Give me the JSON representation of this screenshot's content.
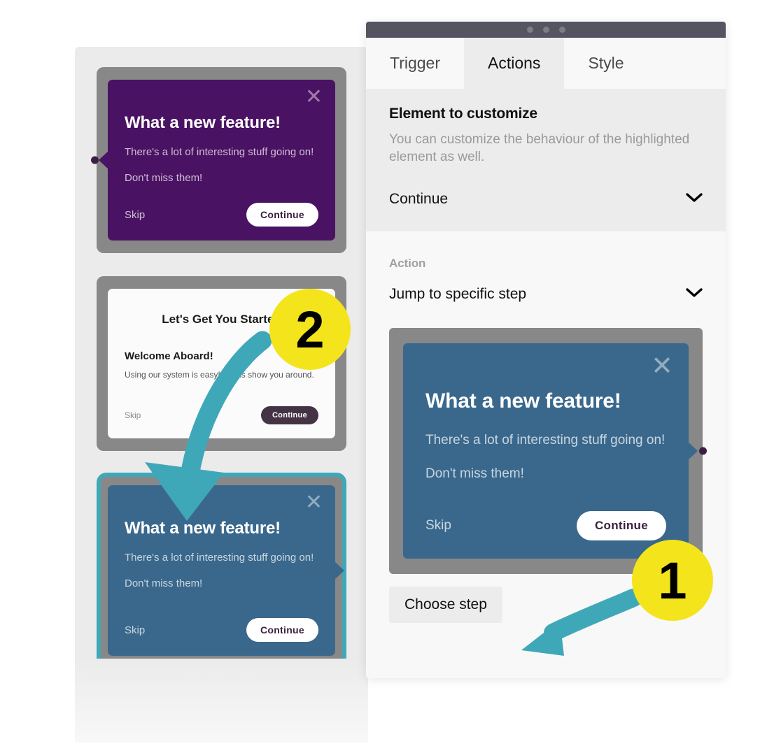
{
  "editor": {
    "window_dots": [
      "dot-1",
      "dot-2",
      "dot-3"
    ],
    "tabs": [
      {
        "label": "Trigger",
        "active": false
      },
      {
        "label": "Actions",
        "active": true
      },
      {
        "label": "Style",
        "active": false
      }
    ],
    "element_section": {
      "title": "Element to customize",
      "description": "You can customize the behaviour of the highlighted element as well.",
      "selected_element": "Continue",
      "dropdown_icon": "chevron-down-icon"
    },
    "action_section": {
      "label": "Action",
      "selected_action": "Jump to specific step",
      "dropdown_icon": "chevron-down-icon",
      "choose_step_label": "Choose step"
    },
    "preview_step": {
      "title": "What a new feature!",
      "body_line1": "There's a lot of interesting stuff going on!",
      "body_line2": "Don't miss them!",
      "skip_label": "Skip",
      "continue_label": "Continue",
      "close_icon": "close-icon",
      "background_color": "#3a688c"
    }
  },
  "steps_panel": {
    "steps": [
      {
        "title": "What a new feature!",
        "body_line1": "There's a lot of interesting stuff going on!",
        "body_line2": "Don't miss them!",
        "skip_label": "Skip",
        "continue_label": "Continue",
        "close_icon": "close-icon",
        "background_color": "#4a1263",
        "selected": false
      },
      {
        "heading": "Let's Get You Started",
        "subheading": "Welcome Aboard!",
        "paragraph": "Using our system is easy! Let us show you around.",
        "skip_label": "Skip",
        "continue_label": "Continue",
        "background_color": "#fbfbfb",
        "selected": false
      },
      {
        "title": "What a new feature!",
        "body_line1": "There's a lot of interesting stuff going on!",
        "body_line2": "Don't miss them!",
        "skip_label": "Skip",
        "continue_label": "Continue",
        "close_icon": "close-icon",
        "background_color": "#3a688c",
        "selected": true
      }
    ]
  },
  "callouts": [
    {
      "number": "1",
      "color": "#f4e41b"
    },
    {
      "number": "2",
      "color": "#f4e41b"
    }
  ],
  "colors": {
    "accent_teal": "#3fa8b8",
    "badge_yellow": "#f4e41b",
    "card_frame_gray": "#888888",
    "purple": "#4a1263",
    "blue": "#3a688c",
    "titlebar": "#555461"
  }
}
